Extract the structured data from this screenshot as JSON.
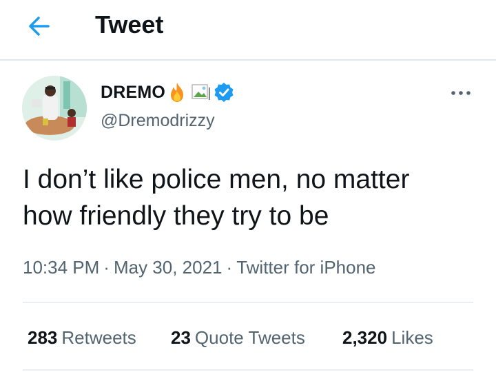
{
  "header": {
    "title": "Tweet",
    "back_icon": "arrow-left-icon"
  },
  "author": {
    "display_name": "DREMO",
    "handle": "@Dremodrizzy",
    "verified": true,
    "emoji": "fire-icon"
  },
  "tweet": {
    "text_line1": "I don’t like police men, no matter",
    "text_line2": "how friendly they try to be",
    "time": "10:34 PM",
    "date": "May 30, 2021",
    "source": "Twitter for iPhone"
  },
  "stats": {
    "retweets_count": "283",
    "retweets_label": "Retweets",
    "quotes_count": "23",
    "quotes_label": "Quote Tweets",
    "likes_count": "2,320",
    "likes_label": "Likes"
  },
  "colors": {
    "accent": "#1d9bf0",
    "text": "#0f1419",
    "secondary": "#536471",
    "divider": "#eceff1"
  }
}
